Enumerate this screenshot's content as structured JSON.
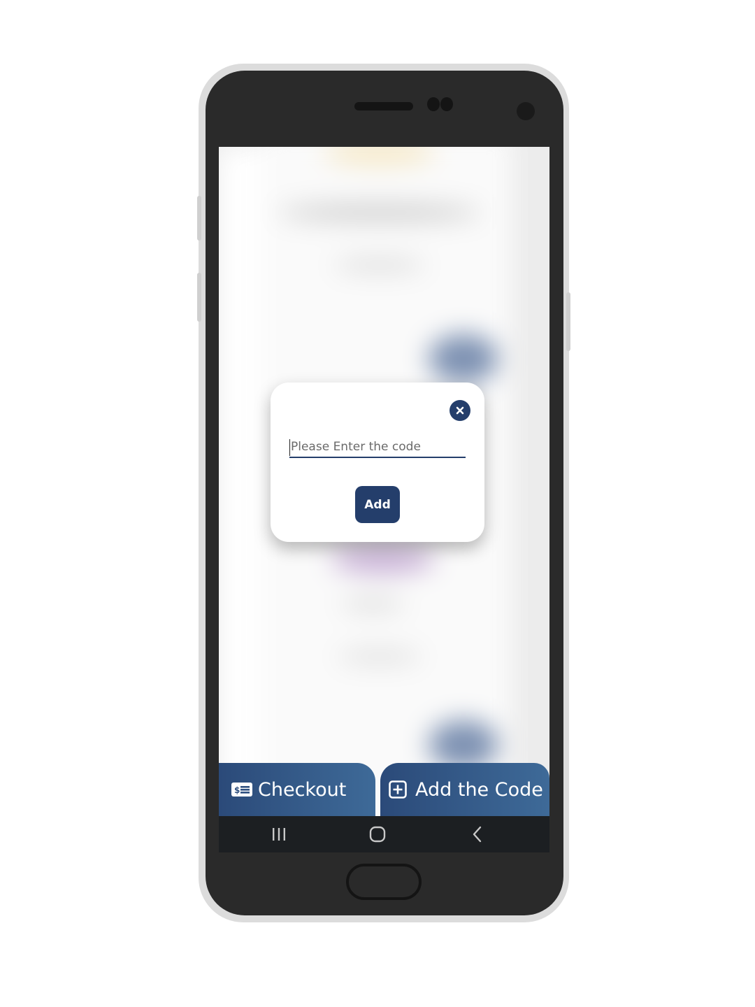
{
  "dialog": {
    "input_placeholder": "Please Enter the code",
    "input_value": "",
    "add_label": "Add",
    "close_icon": "close-icon"
  },
  "bottom_actions": {
    "checkout_label": "Checkout",
    "checkout_icon": "money-bill-icon",
    "add_code_label": "Add the Code",
    "add_code_icon": "plus-square-icon"
  },
  "nav_bar": {
    "items": [
      "recent-apps-icon",
      "home-icon",
      "back-icon"
    ]
  },
  "colors": {
    "primary": "#243e6b",
    "button_gradient_start": "#2b4a79",
    "button_gradient_end": "#3e6a98",
    "nav_bar": "#1c1f22"
  }
}
